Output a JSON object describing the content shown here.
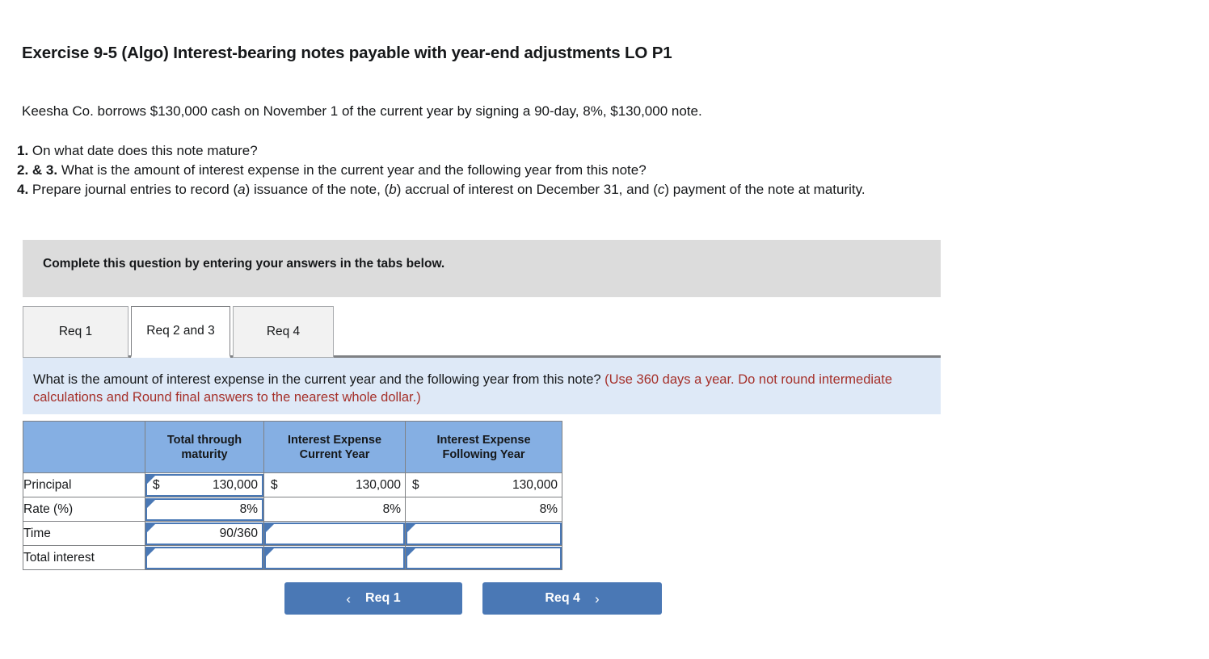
{
  "exercise": {
    "title": "Exercise 9-5 (Algo) Interest-bearing notes payable with year-end adjustments LO P1",
    "intro": "Keesha Co. borrows $130,000 cash on November 1 of the current year by signing a 90-day, 8%, $130,000 note.",
    "requirements": [
      {
        "number": "1.",
        "text": " On what date does this note mature?"
      },
      {
        "number": "2. & 3.",
        "text": " What is the amount of interest expense in the current year and the following year from this note?"
      },
      {
        "number": "4.",
        "text_parts": [
          "Prepare journal entries to record (",
          "a",
          ") issuance of the note, (",
          "b",
          ") accrual of interest on December 31, and (",
          "c",
          ") payment of the note at maturity."
        ]
      }
    ]
  },
  "complete_bar": {
    "text": "Complete this question by entering your answers in the tabs below."
  },
  "tabs": {
    "items": [
      {
        "label": "Req 1",
        "active": false
      },
      {
        "label": "Req 2 and 3",
        "active": true
      },
      {
        "label": "Req 4",
        "active": false
      }
    ]
  },
  "instruction_panel": {
    "question": "What is the amount of interest expense in the current year and the following year from this note? ",
    "hint": "(Use 360 days a year. Do not round intermediate calculations and Round final answers to the nearest whole dollar.)"
  },
  "answer_table": {
    "headers": [
      "",
      "Total through maturity",
      "Interest Expense Current Year",
      "Interest Expense Following Year"
    ],
    "header_lines": [
      [
        "",
        ""
      ],
      [
        "Total through",
        "maturity"
      ],
      [
        "Interest Expense",
        "Current Year"
      ],
      [
        "Interest Expense",
        "Following Year"
      ]
    ],
    "rows": [
      {
        "label": "Principal",
        "cells": [
          {
            "input": true,
            "dollar": "$",
            "value": "130,000"
          },
          {
            "input": false,
            "dollar": "$",
            "value": "130,000"
          },
          {
            "input": false,
            "dollar": "$",
            "value": "130,000"
          }
        ]
      },
      {
        "label": "Rate (%)",
        "cells": [
          {
            "input": true,
            "dollar": "",
            "value": "8%"
          },
          {
            "input": false,
            "dollar": "",
            "value": "8%"
          },
          {
            "input": false,
            "dollar": "",
            "value": "8%"
          }
        ]
      },
      {
        "label": "Time",
        "cells": [
          {
            "input": true,
            "dollar": "",
            "value": "90/360"
          },
          {
            "input": true,
            "dollar": "",
            "value": ""
          },
          {
            "input": true,
            "dollar": "",
            "value": ""
          }
        ]
      },
      {
        "label": "Total interest",
        "cells": [
          {
            "input": true,
            "dollar": "",
            "value": ""
          },
          {
            "input": true,
            "dollar": "",
            "value": ""
          },
          {
            "input": true,
            "dollar": "",
            "value": ""
          }
        ]
      }
    ]
  },
  "nav": {
    "prev": {
      "label": "Req 1",
      "chevron": "‹"
    },
    "next": {
      "label": "Req 4",
      "chevron": "›"
    }
  },
  "colors": {
    "header_blue": "#85afe3",
    "panel_blue": "#dee9f7",
    "gray_bar": "#dcdcdc",
    "button_blue": "#4a78b5",
    "hint_red": "#a5302a",
    "border_gray": "#7f8184"
  }
}
